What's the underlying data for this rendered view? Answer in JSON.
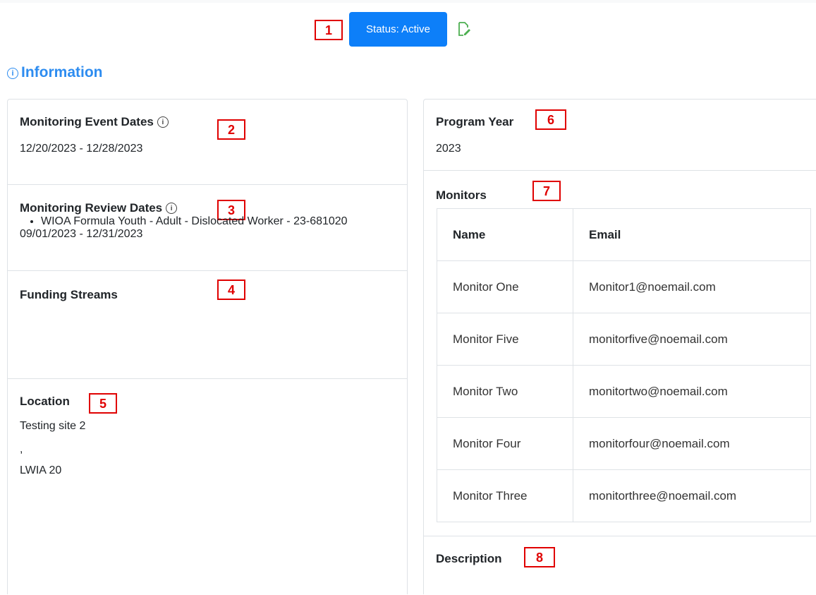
{
  "header": {
    "status_label": "Status: Active"
  },
  "section_title": "Information",
  "left_card": {
    "event_dates": {
      "label": "Monitoring Event Dates",
      "value": "12/20/2023 - 12/28/2023"
    },
    "review_dates": {
      "label": "Monitoring Review Dates",
      "value": "09/01/2023 - 12/31/2023"
    },
    "funding_streams": {
      "label": "Funding Streams",
      "items": [
        "WIOA Formula Youth - Adult - Dislocated Worker - 23-681020"
      ]
    },
    "location": {
      "label": "Location",
      "line1": "Testing site 2",
      "line2": ",",
      "line3": "LWIA 20"
    }
  },
  "right_card": {
    "program_year": {
      "label": "Program Year",
      "value": "2023"
    },
    "monitors": {
      "label": "Monitors",
      "columns": [
        "Name",
        "Email"
      ],
      "rows": [
        [
          "Monitor One",
          "Monitor1@noemail.com"
        ],
        [
          "Monitor Five",
          "monitorfive@noemail.com"
        ],
        [
          "Monitor Two",
          "monitortwo@noemail.com"
        ],
        [
          "Monitor Four",
          "monitorfour@noemail.com"
        ],
        [
          "Monitor Three",
          "monitorthree@noemail.com"
        ]
      ]
    },
    "description": {
      "label": "Description"
    }
  },
  "markers": [
    "1",
    "2",
    "3",
    "4",
    "5",
    "6",
    "7",
    "8"
  ],
  "icons": {
    "edit": "edit-icon",
    "info": "info-icon"
  },
  "colors": {
    "status_button": "#0d7ff9",
    "info_title": "#2d8cf0",
    "edit_icon": "#4caf50",
    "marker": "#e00000"
  }
}
